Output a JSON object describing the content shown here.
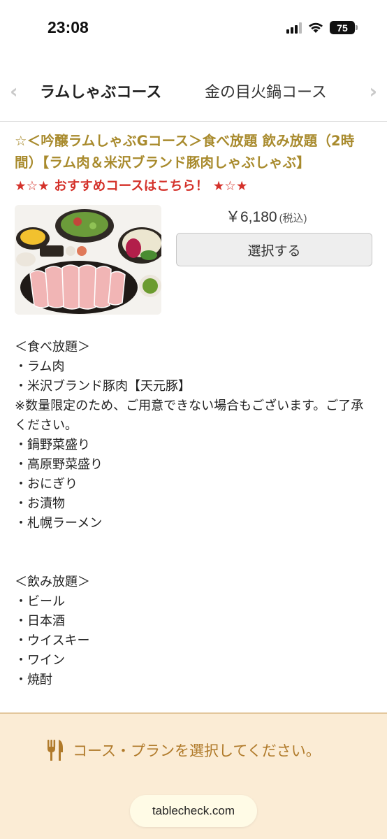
{
  "status_bar": {
    "time": "23:08",
    "battery": "75"
  },
  "tabs": [
    {
      "label": "ラムしゃぶコース"
    },
    {
      "label": "金の目火鍋コース"
    }
  ],
  "course": {
    "title": "☆＜吟醸ラムしゃぶGコース＞食べ放題 飲み放題（2時間）【ラム肉＆米沢ブランド豚肉しゃぶしゃぶ】",
    "recommend": "★☆★ おすすめコースはこちら！ ★☆★",
    "price": "￥6,180",
    "tax_note": "(税込)",
    "select_label": "選択する",
    "details": "＜食べ放題＞\n・ラム肉\n・米沢ブランド豚肉【天元豚】\n※数量限定のため、ご用意できない場合もございます。ご了承ください。\n・鍋野菜盛り\n・高原野菜盛り\n・おにぎり\n・お漬物\n・札幌ラーメン\n\n\n＜飲み放題＞\n・ビール\n・日本酒\n・ウイスキー\n・ワイン\n・焼酎"
  },
  "footer": {
    "cta": "コース・プランを選択してください。",
    "url": "tablecheck.com"
  },
  "colors": {
    "title_gold": "#a88a2c",
    "recommend_red": "#d4312a",
    "footer_bg": "#fbecd5",
    "footer_text": "#b07a2a"
  }
}
